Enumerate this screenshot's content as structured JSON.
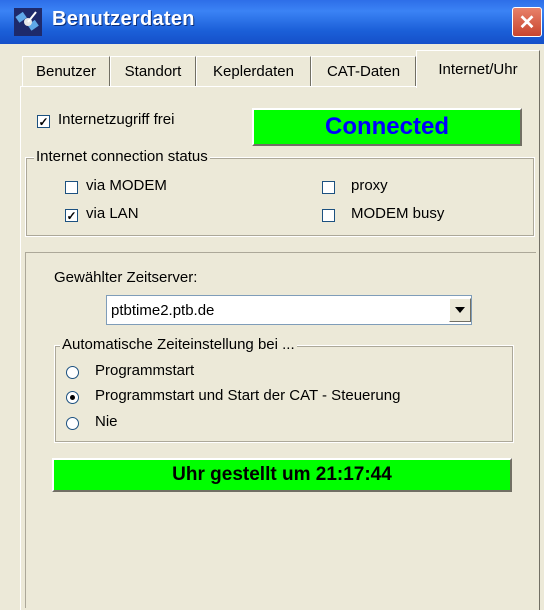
{
  "window": {
    "title": "Benutzerdaten",
    "close_glyph": "✕"
  },
  "tabs": [
    {
      "label": "Benutzer",
      "active": false
    },
    {
      "label": "Standort",
      "active": false
    },
    {
      "label": "Keplerdaten",
      "active": false
    },
    {
      "label": "CAT-Daten",
      "active": false
    },
    {
      "label": "Internet/Uhr",
      "active": true
    }
  ],
  "internet": {
    "access_label": "Internetzugriff frei",
    "access_checked": true,
    "status_text": "Connected",
    "status_color": "#0000FF"
  },
  "connection_group": {
    "legend": "Internet connection status",
    "items": [
      {
        "label": "via MODEM",
        "checked": false
      },
      {
        "label": "via LAN",
        "checked": true
      },
      {
        "label": "proxy",
        "checked": false
      },
      {
        "label": "MODEM busy",
        "checked": false
      }
    ]
  },
  "timeserver": {
    "label": "Gewählter Zeitserver:",
    "value": "ptbtime2.ptb.de"
  },
  "auto_group": {
    "legend": "Automatische Zeiteinstellung bei ...",
    "options": [
      {
        "label": "Programmstart",
        "selected": false
      },
      {
        "label": "Programmstart und Start der CAT - Steuerung",
        "selected": true
      },
      {
        "label": "Nie",
        "selected": false
      }
    ]
  },
  "clock_status": "Uhr gestellt um 21:17:44",
  "colors": {
    "accent_green": "#00FF00",
    "titlebar_blue": "#2D6EE8"
  },
  "icons": {
    "app": "satellite-icon",
    "check": "✓"
  }
}
